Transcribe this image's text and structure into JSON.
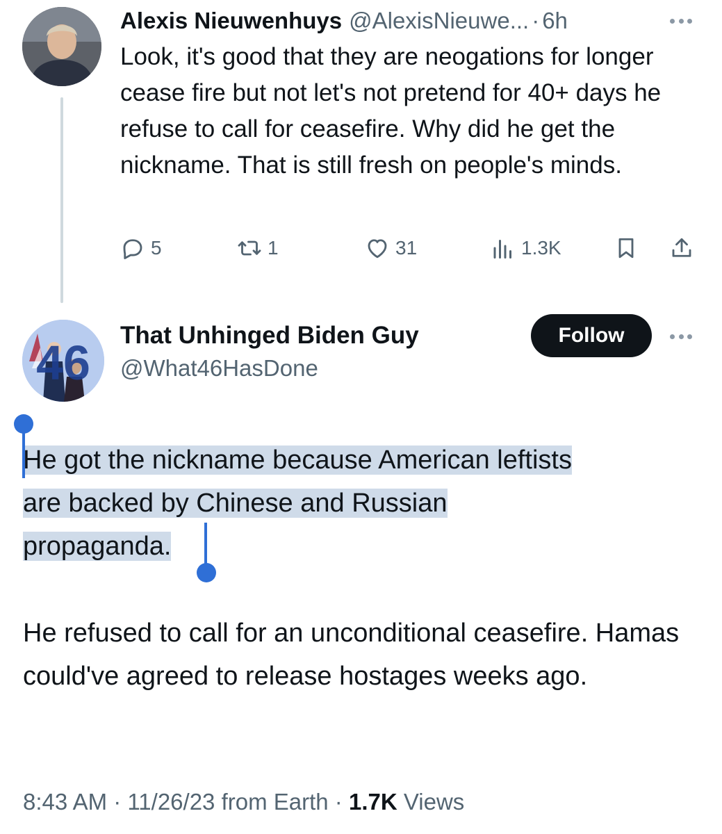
{
  "reply_tweet": {
    "display_name": "Alexis Nieuwenhuys",
    "handle": "@AlexisNieuwe...",
    "separator": "·",
    "time": "6h",
    "text": "Look, it's good that they are neogations for longer cease fire but not let's not pretend for 40+ days he refuse to call for ceasefire. Why did he get the nickname. That is still fresh on people's minds.",
    "stats": {
      "replies": "5",
      "retweets": "1",
      "likes": "31",
      "views": "1.3K"
    }
  },
  "main_tweet": {
    "display_name": "That Unhinged Biden Guy",
    "handle": "@What46HasDone",
    "follow_label": "Follow",
    "avatar_text": "46",
    "paragraph1_line1": "He got the nickname because American leftists",
    "paragraph1_line2": "are backed by Chinese and Russian",
    "paragraph1_line3": "propaganda.",
    "paragraph2": "He refused to call for an unconditional ceasefire. Hamas could've agreed to release hostages weeks ago.",
    "meta": {
      "time": "8:43 AM",
      "sep1": " · ",
      "date": "11/26/23",
      "source": " from Earth",
      "sep2": " · ",
      "views_count": "1.7K",
      "views_label": " Views"
    }
  },
  "colors": {
    "text": "#0f1419",
    "secondary": "#536471",
    "selection_highlight": "#cfdbe9",
    "selection_handle": "#2f6fd6",
    "follow_button": "#0f1419"
  },
  "icons": [
    "reply-icon",
    "retweet-icon",
    "like-icon",
    "views-icon",
    "bookmark-icon",
    "share-icon",
    "more-icon"
  ]
}
